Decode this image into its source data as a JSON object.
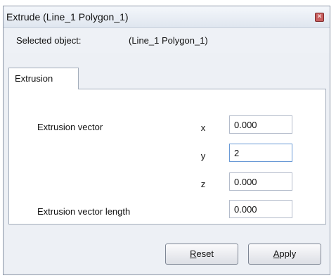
{
  "window": {
    "title": "Extrude (Line_1 Polygon_1)",
    "close_glyph": "✕"
  },
  "selection": {
    "label": "Selected object:",
    "value": "(Line_1 Polygon_1)"
  },
  "tabs": [
    {
      "label": "Extrusion",
      "active": true
    }
  ],
  "extrusion": {
    "vector_label": "Extrusion vector",
    "x_label": "x",
    "x_value": "0.000",
    "y_label": "y",
    "y_value": "2",
    "z_label": "z",
    "z_value": "0.000",
    "length_label": "Extrusion vector length",
    "length_value": "0.000"
  },
  "buttons": {
    "reset_first": "R",
    "reset_rest": "eset",
    "apply_first": "A",
    "apply_rest": "pply"
  }
}
